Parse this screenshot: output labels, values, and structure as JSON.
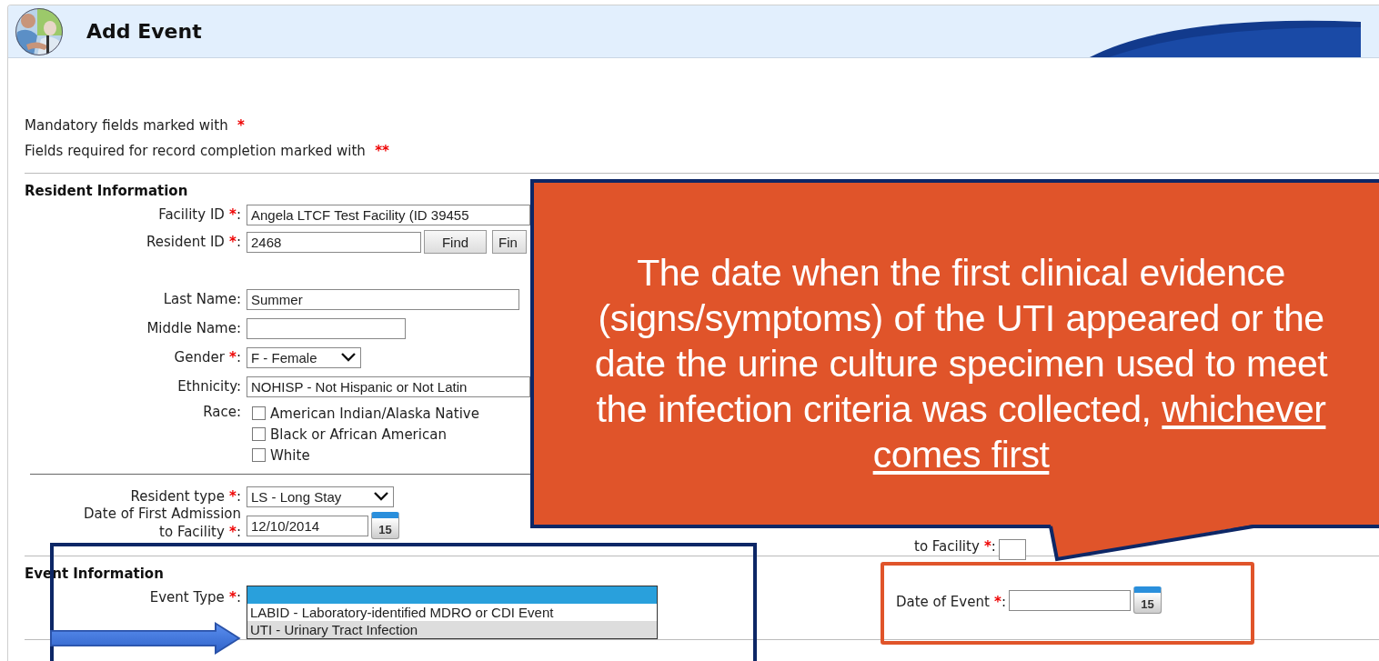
{
  "header": {
    "title": "Add Event"
  },
  "legend": [
    {
      "text": "Mandatory fields marked with",
      "marker": "*"
    },
    {
      "text": "Fields required for record completion marked with",
      "marker": "**"
    }
  ],
  "resident_section": {
    "heading": "Resident Information",
    "identity_fields": [
      {
        "kind": "text",
        "label": "Facility ID",
        "mark": "*",
        "label_end": ":",
        "value": "Angela LTCF Test Facility (ID 39455"
      },
      {
        "kind": "text",
        "label": "Resident ID",
        "mark": "*",
        "label_end": ":",
        "value": "2468",
        "buttons": [
          "Find",
          "Fin"
        ]
      }
    ],
    "demographic_fields": [
      {
        "kind": "text",
        "label": "Last Name:",
        "value": "Summer"
      },
      {
        "kind": "text",
        "label": "Middle Name:"
      },
      {
        "kind": "select",
        "label": "Gender",
        "mark": "*",
        "label_end": ":",
        "value": "F - Female"
      },
      {
        "kind": "text",
        "label": "Ethnicity:",
        "value": "NOHISP - Not Hispanic or Not Latin"
      },
      {
        "kind": "checkboxes",
        "label": "Race:",
        "options": [
          {
            "label": "American Indian/Alaska Native",
            "checked": false
          },
          {
            "label": "Black or African American",
            "checked": false
          },
          {
            "label": "White",
            "checked": false
          }
        ]
      }
    ],
    "stay_fields": [
      {
        "kind": "select",
        "label": "Resident type",
        "mark": "*",
        "label_end": ":",
        "value": "LS - Long Stay"
      },
      {
        "kind": "date",
        "label": "Date of First Admission\nto Facility",
        "mark": "*",
        "label_end": ":",
        "value": "12/10/2014",
        "calendar": "15",
        "right": {
          "label": "to Facility",
          "mark": "*",
          "label_end": ":"
        }
      }
    ]
  },
  "event_section": {
    "heading": "Event Information",
    "event_type": {
      "label": "Event Type",
      "mark": "*",
      "label_end": ":",
      "blank_highlighted": true,
      "options": [
        {
          "label": "LABID - Laboratory-identified MDRO or CDI Event",
          "selected": false
        },
        {
          "label": "UTI - Urinary Tract Infection",
          "selected": true
        }
      ]
    },
    "date_of_event": {
      "label": "Date of Event",
      "mark": "*",
      "label_end": ":",
      "calendar": "15"
    }
  },
  "callout": {
    "text": "The date when the first clinical evidence\n(signs/symptoms) of the UTI appeared or the\ndate the urine culture specimen used to meet\nthe infection criteria was collected, ",
    "emphasis": "whichever\ncomes first"
  }
}
